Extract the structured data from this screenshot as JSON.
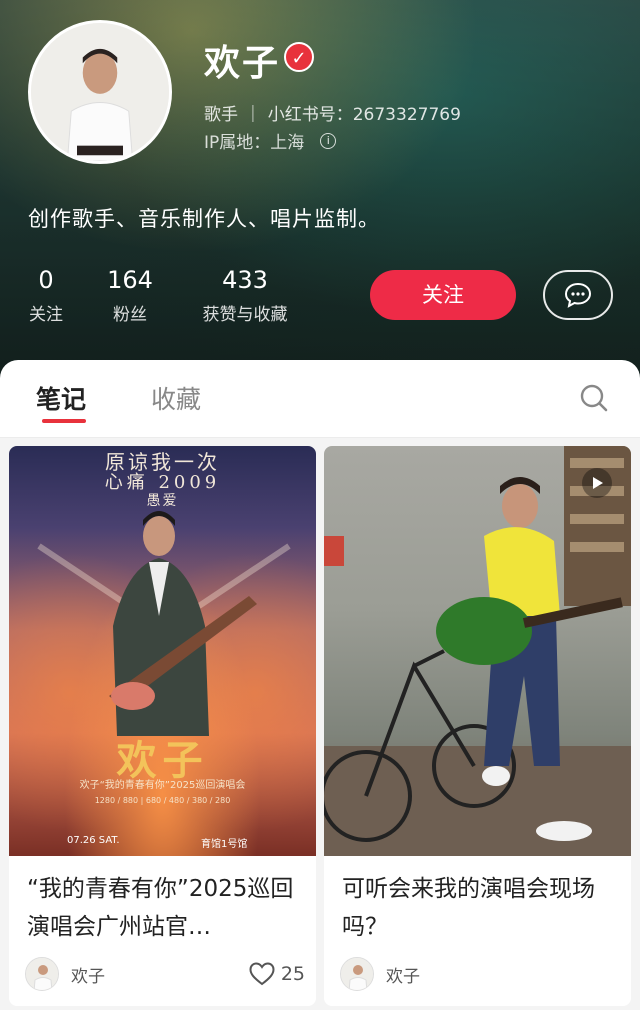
{
  "profile": {
    "name": "欢子",
    "role": "歌手",
    "id_text": "小红书号：2673327769",
    "ip_text": "IP属地：上海",
    "bio": "创作歌手、音乐制作人、唱片监制。",
    "stats": [
      {
        "num": "0",
        "label": "关注"
      },
      {
        "num": "164",
        "label": "粉丝"
      },
      {
        "num": "433",
        "label": "获赞与收藏"
      }
    ],
    "follow_label": "关注",
    "verified_icon": "verified-check-icon",
    "info_icon": "info-icon",
    "message_icon": "chat-bubble-icon"
  },
  "tabs": {
    "active": "笔记",
    "inactive": "收藏",
    "search_icon": "search-icon"
  },
  "notes": [
    {
      "title": "“我的青春有你”2025巡回演唱会广州站官…",
      "author": "欢子",
      "likes": "25",
      "poster": {
        "line1": "原谅我一次",
        "line2": "心痛 2009",
        "line3": "愚爱",
        "big": "欢子",
        "sub": "欢子“我的青春有你”2025巡回演唱会",
        "prices": "1280 / 880 | 680 / 480 / 380 / 280",
        "date": "07.26 SAT.",
        "venue": "育馆1号馆"
      }
    },
    {
      "title": "可听会来我的演唱会现场吗？",
      "author": "欢子",
      "play_icon": "play-icon"
    }
  ],
  "colors": {
    "accent": "#ee2b47",
    "tab_underline": "#e8323c"
  }
}
